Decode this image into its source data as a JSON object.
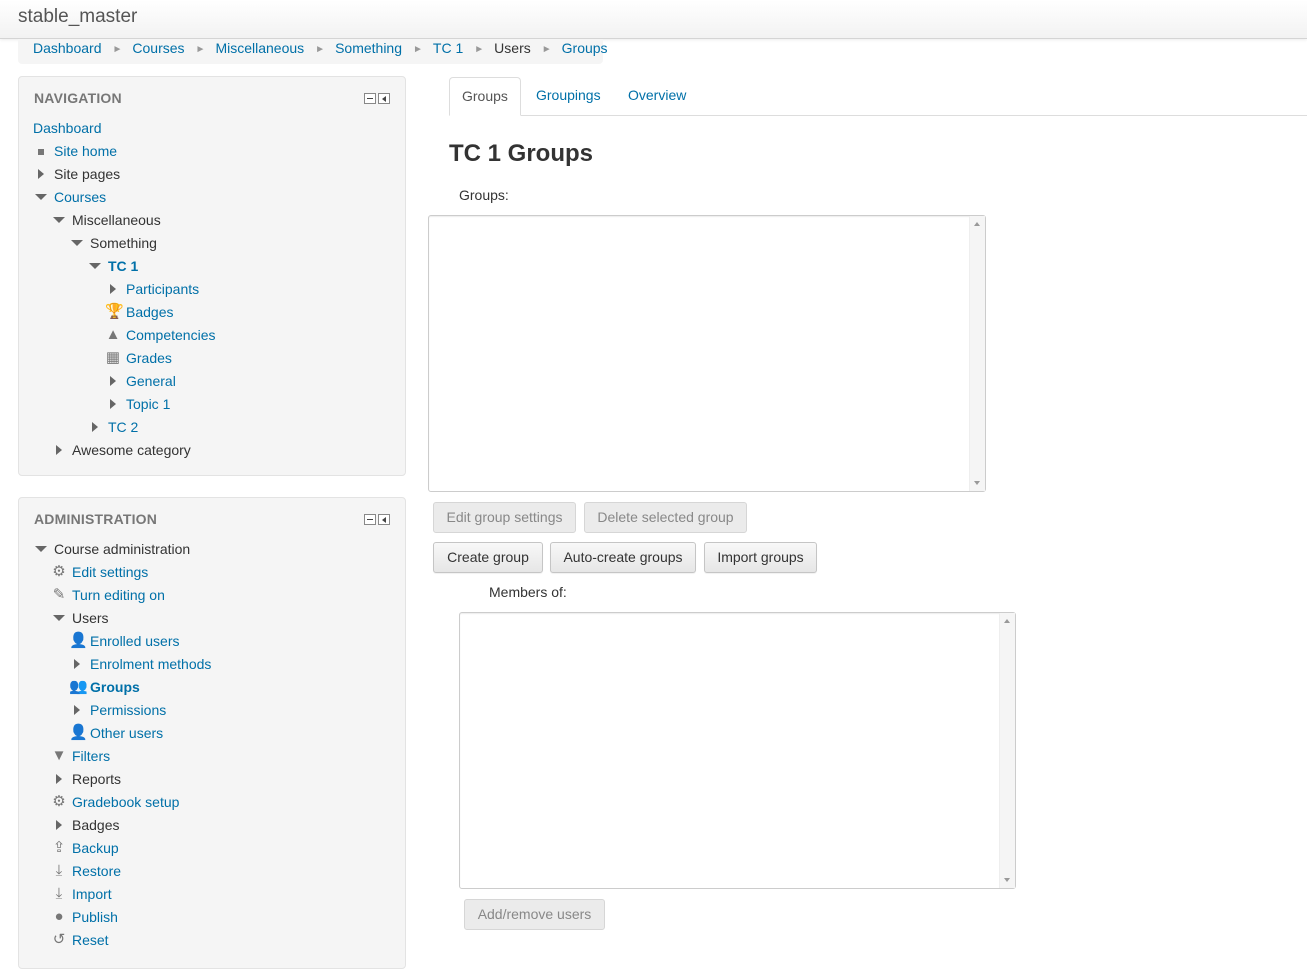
{
  "site": {
    "title": "stable_master"
  },
  "breadcrumb": [
    "Dashboard",
    "Courses",
    "Miscellaneous",
    "Something",
    "TC 1",
    "Users",
    "Groups"
  ],
  "navigation": {
    "heading": "NAVIGATION",
    "items": [
      "Dashboard",
      "Site home",
      "Site pages",
      "Courses",
      "Miscellaneous",
      "Something",
      "TC 1",
      "Participants",
      "Badges",
      "Competencies",
      "Grades",
      "General",
      "Topic 1",
      "TC 2",
      "Awesome category"
    ]
  },
  "administration": {
    "heading": "ADMINISTRATION",
    "items": [
      "Course administration",
      "Edit settings",
      "Turn editing on",
      "Users",
      "Enrolled users",
      "Enrolment methods",
      "Groups",
      "Permissions",
      "Other users",
      "Filters",
      "Reports",
      "Gradebook setup",
      "Badges",
      "Backup",
      "Restore",
      "Import",
      "Publish",
      "Reset"
    ]
  },
  "tabs": [
    "Groups",
    "Groupings",
    "Overview"
  ],
  "main": {
    "title": "TC 1 Groups",
    "groups_label": "Groups:",
    "members_label": "Members of:",
    "buttons": {
      "edit_group": "Edit group settings",
      "delete_group": "Delete selected group",
      "create_group": "Create group",
      "auto_create": "Auto-create groups",
      "import_groups": "Import groups",
      "add_remove": "Add/remove users"
    }
  }
}
